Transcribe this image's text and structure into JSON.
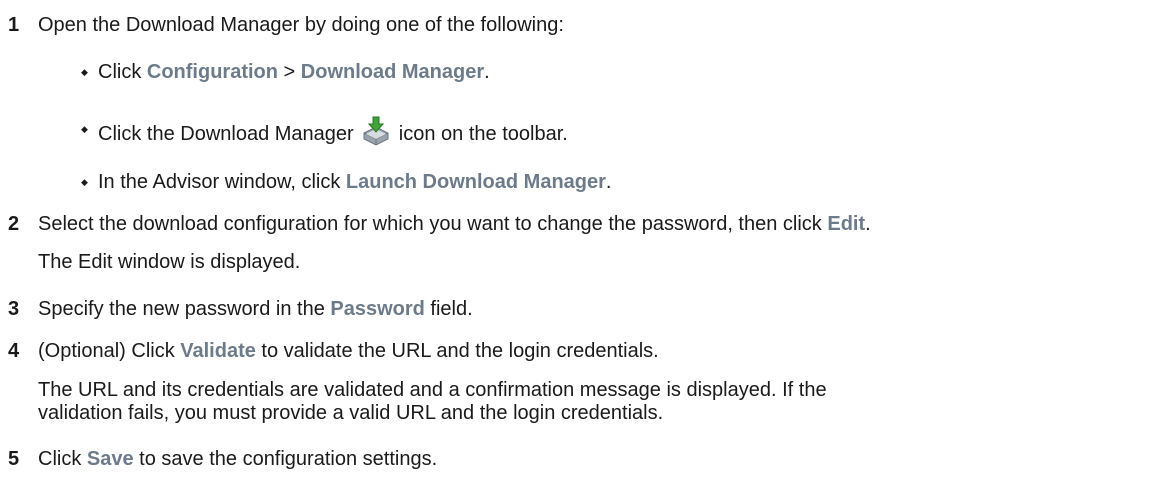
{
  "steps": [
    {
      "number": "1",
      "text": "Open the Download Manager by doing one of the following:",
      "bullets": [
        {
          "pre": "Click ",
          "ui1": "Configuration",
          "mid": " > ",
          "ui2": "Download Manager",
          "post": "."
        },
        {
          "pre": "Click the Download Manager ",
          "icon": "download-manager-icon",
          "post": " icon on the toolbar."
        },
        {
          "pre": "In the Advisor window, click ",
          "ui": "Launch Download Manager",
          "post": "."
        }
      ]
    },
    {
      "number": "2",
      "pre": "Select the download configuration for which you want to change the password, then click ",
      "ui": "Edit",
      "post": ".",
      "note": "The Edit window is displayed."
    },
    {
      "number": "3",
      "pre": "Specify the new password in the ",
      "ui": "Password",
      "post": " field."
    },
    {
      "number": "4",
      "pre": "(Optional) Click ",
      "ui": "Validate",
      "post": " to validate the URL and the login credentials.",
      "note_line1": "The URL and its credentials are validated and a confirmation message is displayed. If the",
      "note_line2": "validation fails, you must provide a valid URL and the login credentials."
    },
    {
      "number": "5",
      "pre": "Click ",
      "ui": "Save",
      "post": " to save the configuration settings."
    }
  ],
  "bullet_glyph": "◆",
  "colors": {
    "ui_text": "#6c7b8b",
    "body_text": "#1a1a1a"
  }
}
